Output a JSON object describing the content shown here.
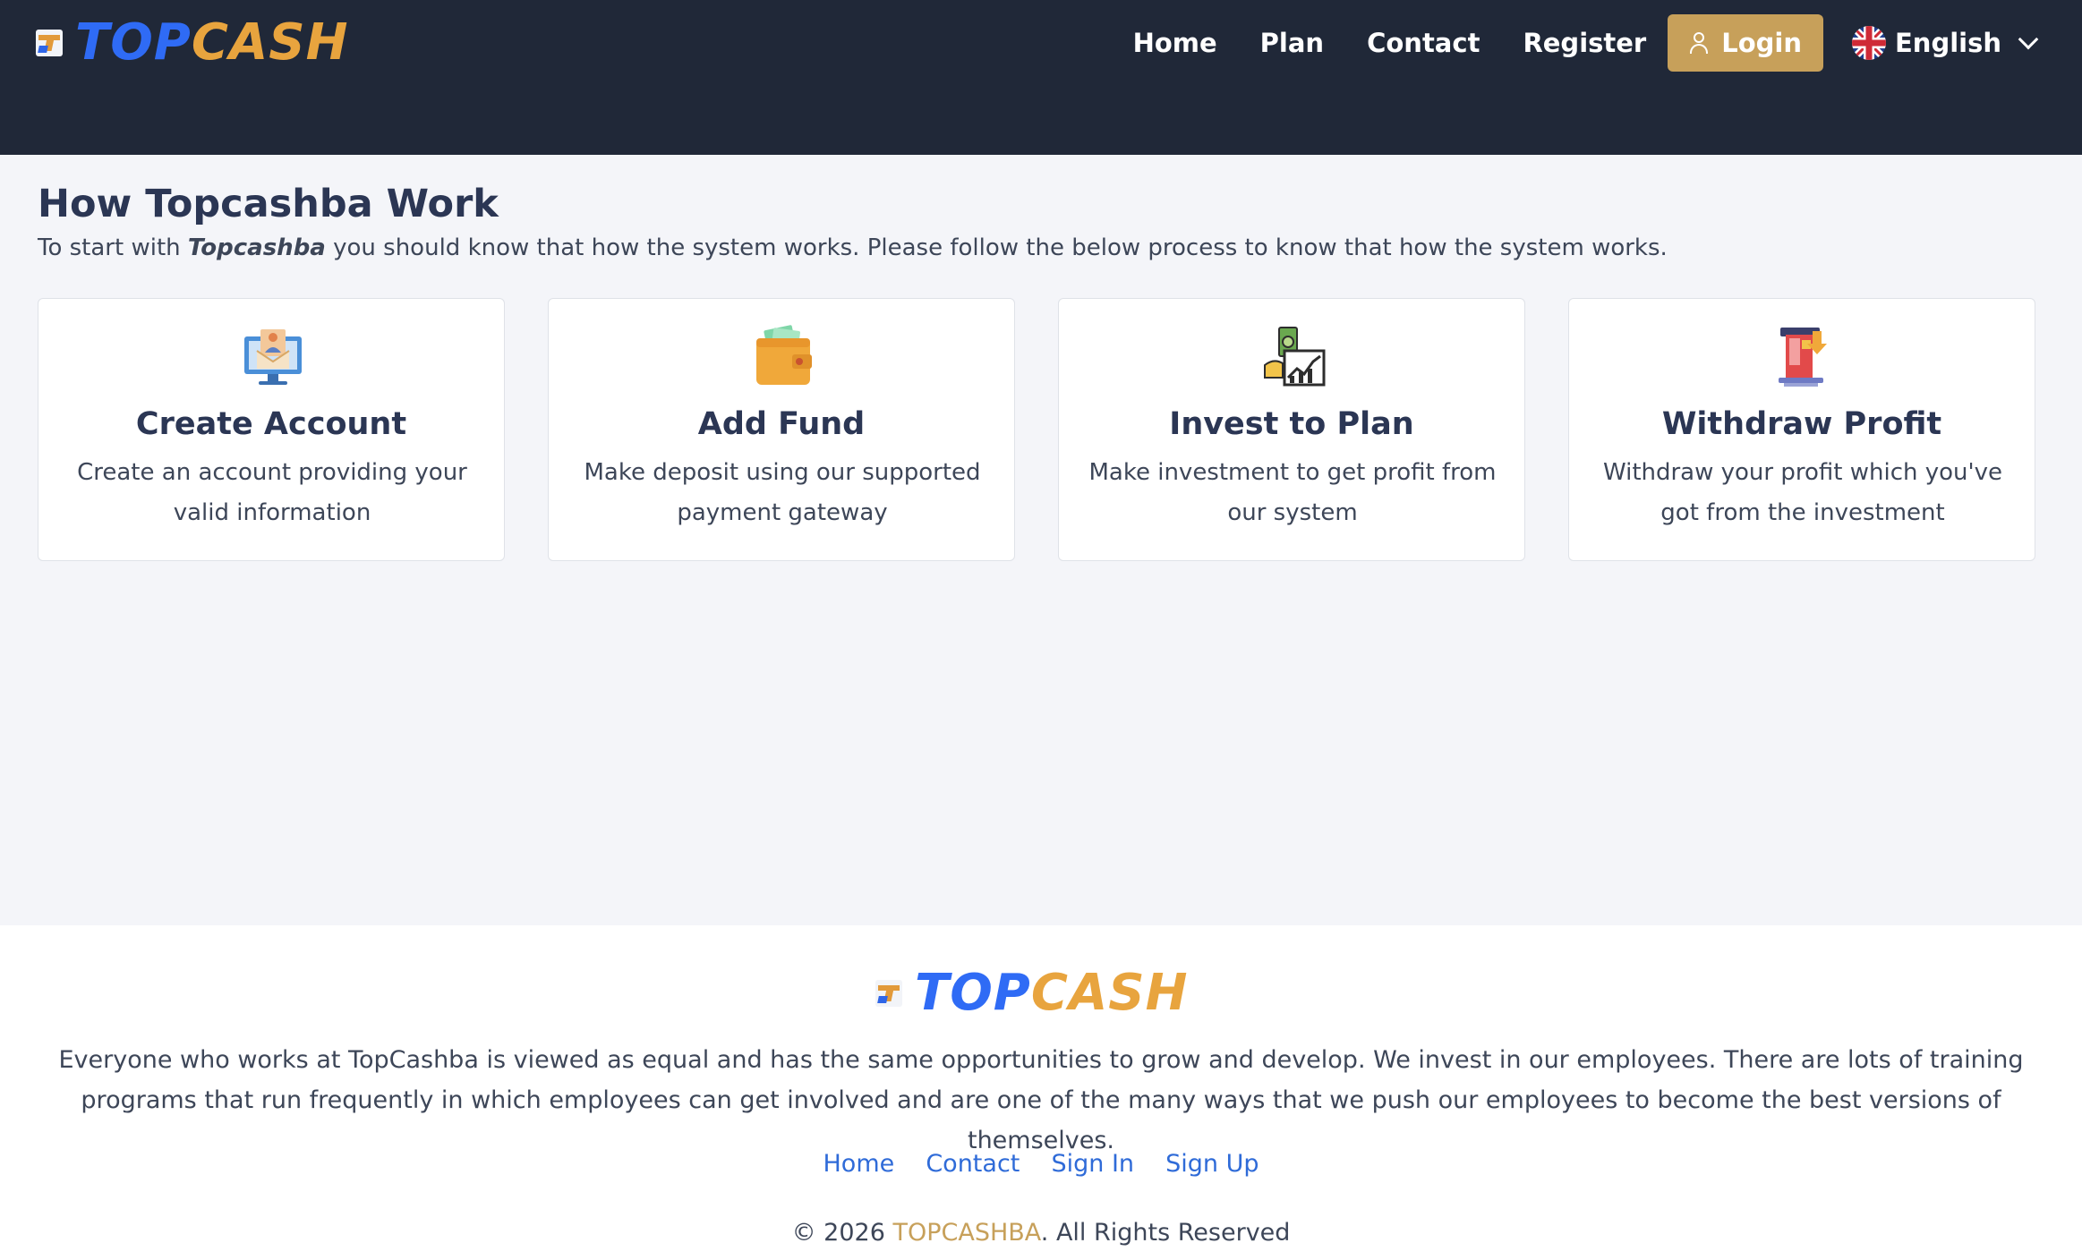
{
  "brand": {
    "logo_part1": "TOP",
    "logo_part2": "CASH",
    "primary_color": "#2f6bf5",
    "accent_color": "#e8a43e"
  },
  "header": {
    "nav": [
      {
        "label": "Home"
      },
      {
        "label": "Plan"
      },
      {
        "label": "Contact"
      },
      {
        "label": "Register"
      }
    ],
    "login_label": "Login",
    "language": "English",
    "background": "#202838",
    "button_color": "#c7a05a"
  },
  "main": {
    "title": "How Topcashba Work",
    "subtitle_pre": "To start with ",
    "subtitle_brand": "Topcashba",
    "subtitle_post": " you should know that how the system works. Please follow the below process to know that how the system works.",
    "steps": [
      {
        "title": "Create Account",
        "text": "Create an account providing your valid information",
        "icon": "create-account-icon"
      },
      {
        "title": "Add Fund",
        "text": "Make deposit using our supported payment gateway",
        "icon": "wallet-icon"
      },
      {
        "title": "Invest to Plan",
        "text": "Make investment to get profit from our system",
        "icon": "invest-chart-icon"
      },
      {
        "title": "Withdraw Profit",
        "text": "Withdraw your profit which you've got from the investment",
        "icon": "withdraw-atm-icon"
      }
    ]
  },
  "footer": {
    "description": "Everyone who works at TopCashba is viewed as equal and has the same opportunities to grow and develop. We invest in our employees. There are lots of training programs that run frequently in which employees can get involved and are one of the many ways that we push our employees to become the best versions of themselves.",
    "links": [
      {
        "label": "Home"
      },
      {
        "label": "Contact"
      },
      {
        "label": "Sign In"
      },
      {
        "label": "Sign Up"
      }
    ],
    "copyright_pre": "© 2026 ",
    "copyright_brand": "TOPCASHBA",
    "copyright_post": ". All Rights Reserved"
  }
}
